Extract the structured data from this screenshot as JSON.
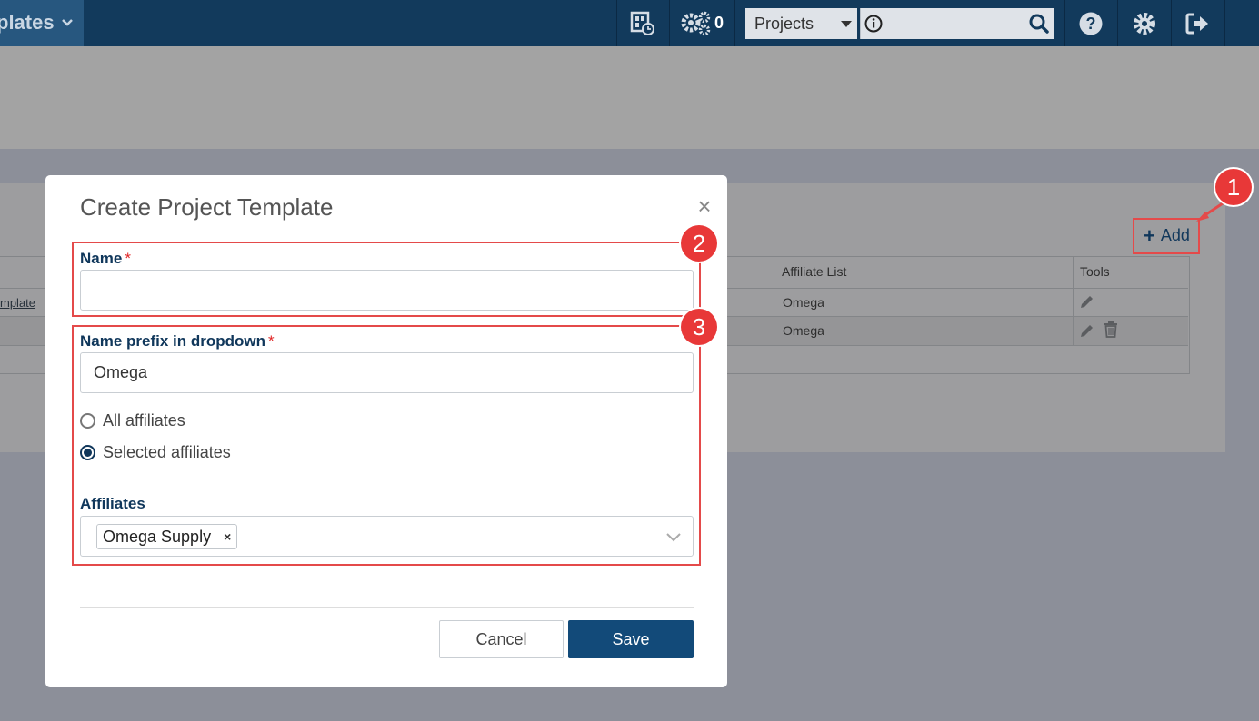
{
  "topbar": {
    "breadcrumb": "plates",
    "gear_count": "0",
    "project_select_value": "Projects",
    "search_placeholder": ""
  },
  "background": {
    "add_label": "Add",
    "columns": [
      "Affiliate List",
      "Tools"
    ],
    "row_link": "mplate",
    "rows": [
      {
        "affiliate": "Omega"
      },
      {
        "affiliate": "Omega"
      }
    ]
  },
  "modal": {
    "title": "Create Project Template",
    "close_label": "×",
    "name_label": "Name",
    "required_mark": "*",
    "name_value": "",
    "prefix_label": "Name prefix in dropdown",
    "prefix_value": "Omega",
    "radio_all": "All affiliates",
    "radio_selected": "Selected affiliates",
    "affiliates_label": "Affiliates",
    "affiliate_chip": "Omega Supply",
    "chip_remove": "×",
    "cancel_label": "Cancel",
    "save_label": "Save"
  },
  "callouts": [
    "1",
    "2",
    "3"
  ],
  "colors": {
    "navbar": "#123a5c",
    "label": "#10375b",
    "save_button": "#124a79",
    "callout": "#e83838"
  }
}
